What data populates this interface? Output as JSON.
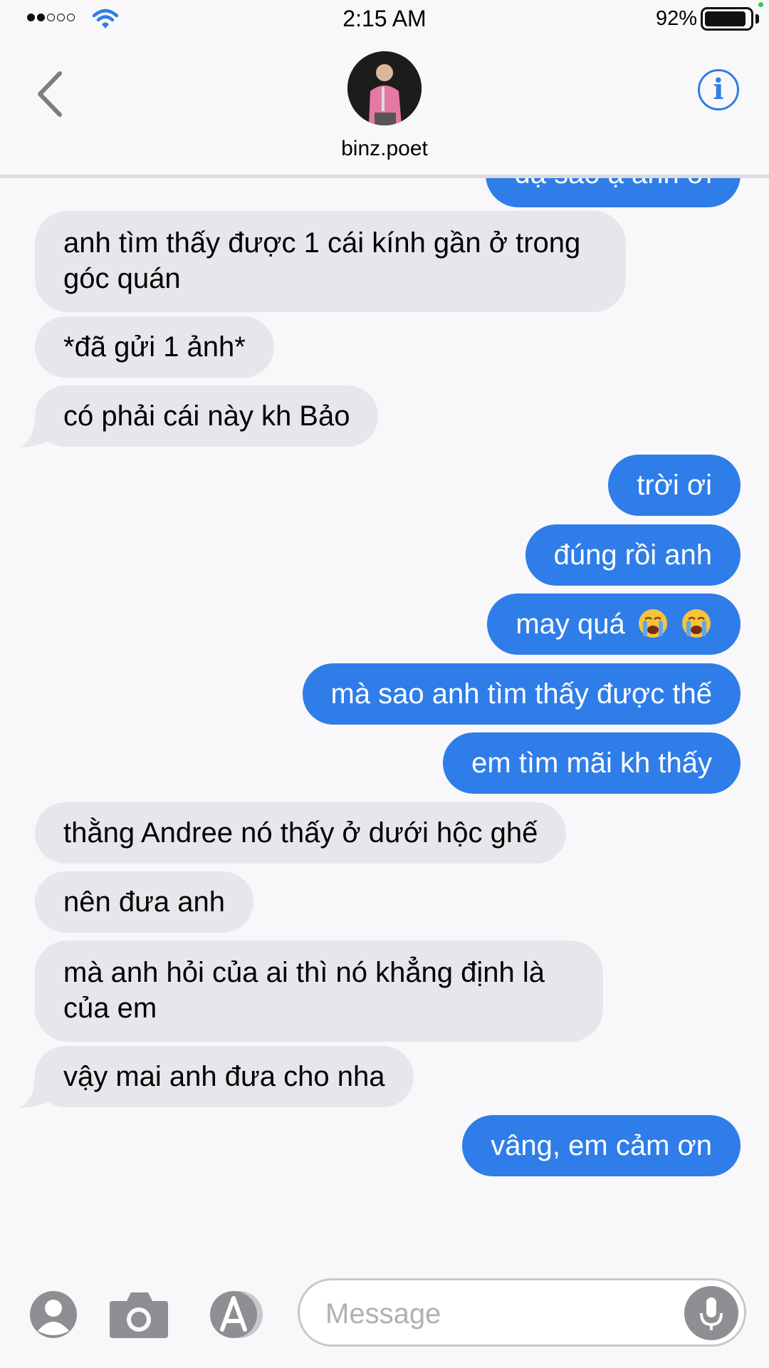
{
  "status_bar": {
    "time": "2:15 AM",
    "battery_percent": "92%",
    "signal_bars_filled": 2,
    "signal_bars_total": 5,
    "battery_level": 0.92
  },
  "header": {
    "contact_name": "binz.poet",
    "back_icon": "chevron-left-icon",
    "info_icon": "info-icon",
    "info_glyph": "i"
  },
  "messages": [
    {
      "side": "sent",
      "text": "dạ sao ạ anh ơi"
    },
    {
      "side": "received",
      "text": "anh tìm thấy được 1 cái kính gần ở trong góc quán"
    },
    {
      "side": "received",
      "text": "*đã gửi 1 ảnh*"
    },
    {
      "side": "received",
      "text": "có phải cái này kh Bảo"
    },
    {
      "side": "sent",
      "text": "trời ơi"
    },
    {
      "side": "sent",
      "text": "đúng rồi anh"
    },
    {
      "side": "sent",
      "text": "may quá",
      "emoji": [
        "loudly-crying-face",
        "loudly-crying-face"
      ]
    },
    {
      "side": "sent",
      "text": "mà sao anh tìm thấy được thế"
    },
    {
      "side": "sent",
      "text": "em tìm mãi kh thấy"
    },
    {
      "side": "received",
      "text": "thằng Andree nó thấy ở dưới hộc ghế"
    },
    {
      "side": "received",
      "text": "nên đưa anh"
    },
    {
      "side": "received",
      "text": "mà anh hỏi của ai thì nó khẳng định là của em"
    },
    {
      "side": "received",
      "text": "vậy mai anh đưa cho nha"
    },
    {
      "side": "sent",
      "text": "vâng, em cảm ơn"
    }
  ],
  "composer": {
    "placeholder": "Message",
    "icons": [
      "contact-icon",
      "camera-icon",
      "app-store-icon",
      "microphone-icon"
    ]
  },
  "colors": {
    "sent_bubble": "#2f7de8",
    "received_bubble": "#e6e6eb",
    "accent": "#2f7de8"
  }
}
